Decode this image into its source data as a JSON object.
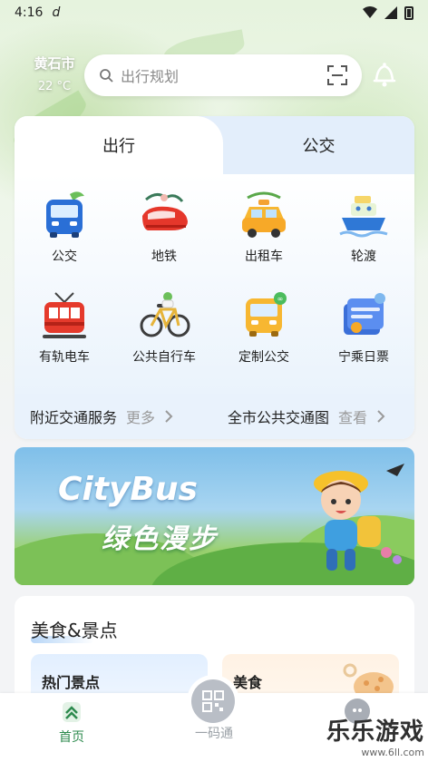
{
  "status_bar": {
    "time": "4:16",
    "extra_glyph": "d"
  },
  "header": {
    "city": "黄石市",
    "temperature": "22 °C",
    "search_placeholder": "出行规划"
  },
  "transit": {
    "tabs": [
      "出行",
      "公交"
    ],
    "active_tab": "出行",
    "items": [
      {
        "label": "公交",
        "icon": "bus-icon"
      },
      {
        "label": "地铁",
        "icon": "metro-icon"
      },
      {
        "label": "出租车",
        "icon": "taxi-icon"
      },
      {
        "label": "轮渡",
        "icon": "ferry-icon"
      },
      {
        "label": "有轨电车",
        "icon": "tram-icon"
      },
      {
        "label": "公共自行车",
        "icon": "bicycle-icon"
      },
      {
        "label": "定制公交",
        "icon": "custom-bus-icon"
      },
      {
        "label": "宁乘日票",
        "icon": "day-ticket-icon"
      }
    ],
    "services": [
      {
        "title": "附近交通服务",
        "action": "更多"
      },
      {
        "title": "全市公共交通图",
        "action": "查看"
      }
    ]
  },
  "banner": {
    "title": "CityBus",
    "subtitle": "绿色漫步"
  },
  "food_section": {
    "title": "美食&景点",
    "cards": [
      "热门景点",
      "美食"
    ]
  },
  "bottom_nav": [
    {
      "label": "首页",
      "active": true
    },
    {
      "label": "一码通",
      "active": false
    }
  ],
  "watermark": {
    "name": "乐乐游戏",
    "url": "www.6ll.com"
  },
  "colors": {
    "accent_green": "#2d8a4e",
    "tab_blue": "#e3eefb",
    "banner_sky": "#7fbfe9"
  }
}
